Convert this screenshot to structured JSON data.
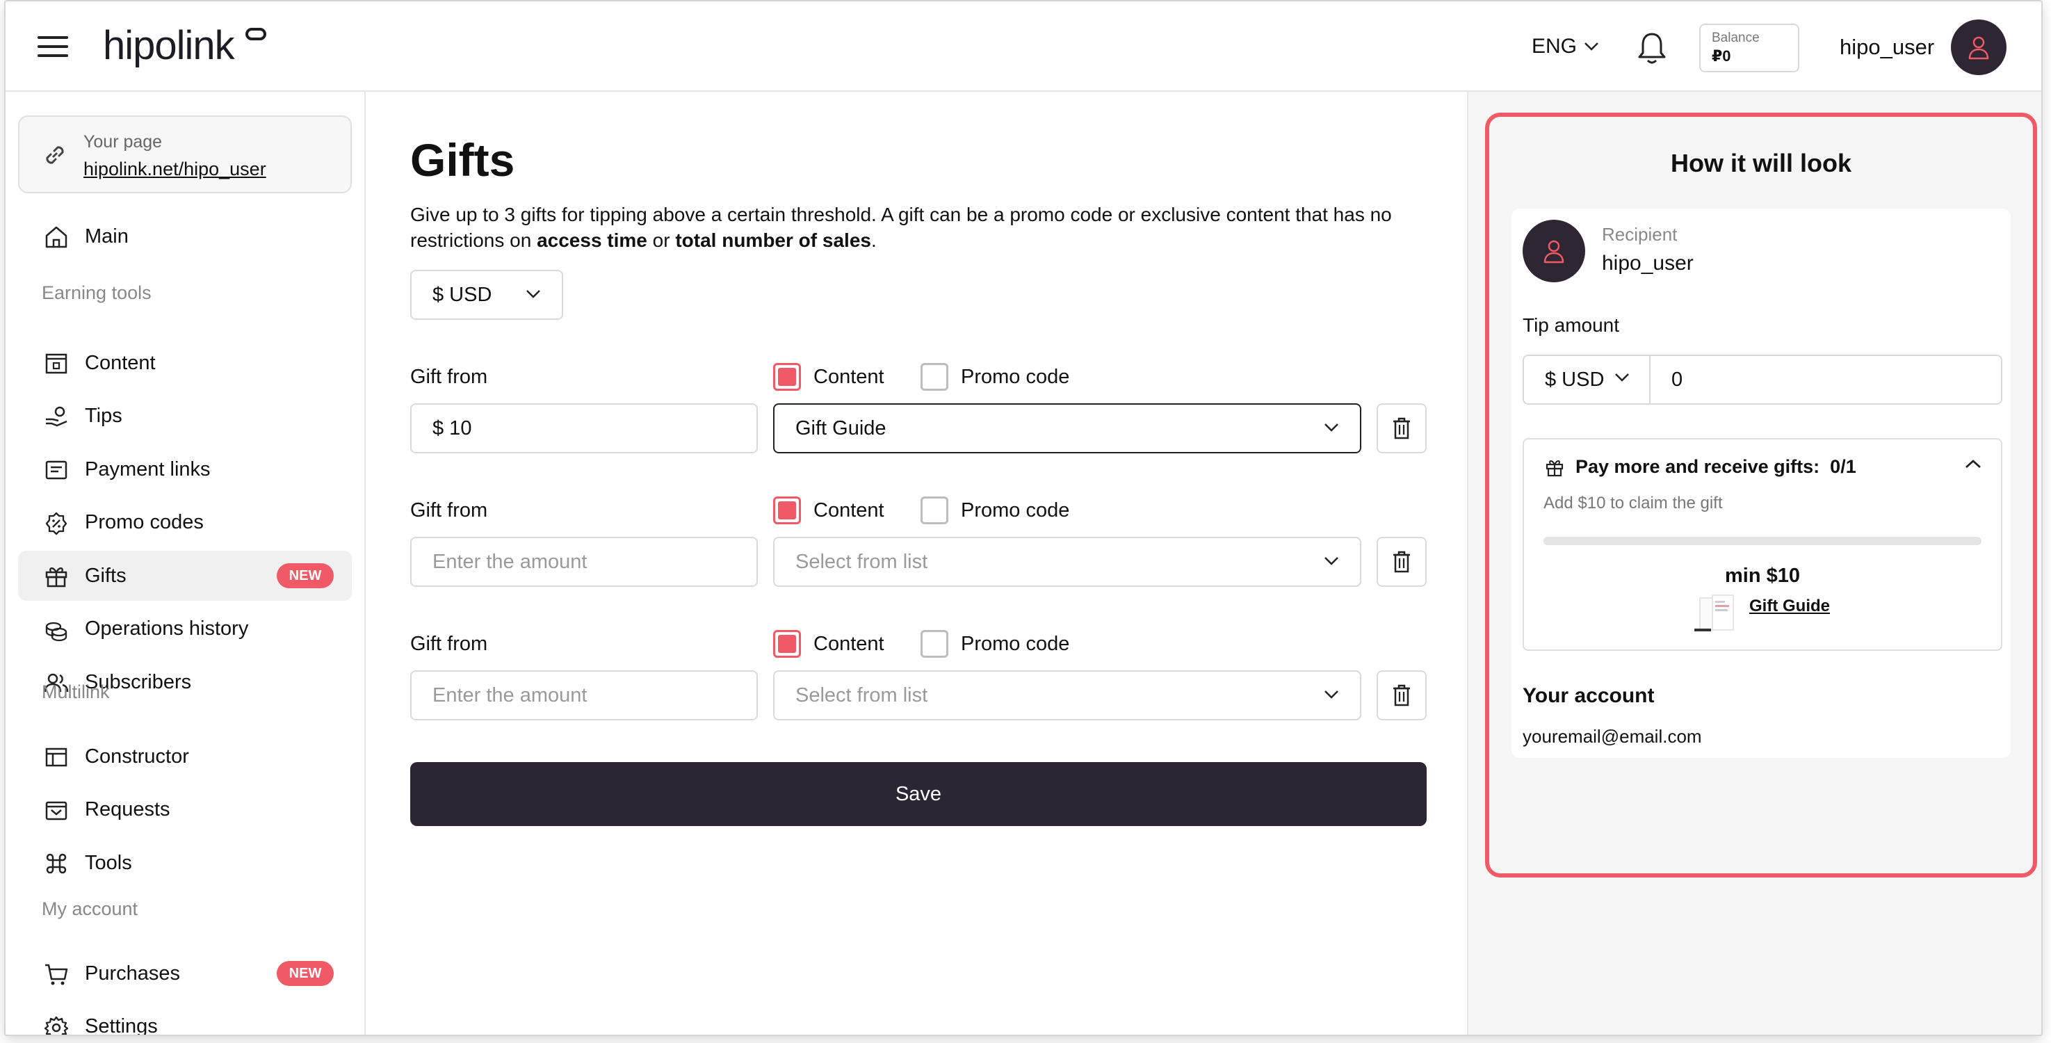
{
  "header": {
    "logo": "hipolink",
    "language": "ENG",
    "balance_label": "Balance",
    "balance_value": "₽0",
    "username": "hipo_user"
  },
  "sidebar": {
    "your_page_label": "Your page",
    "your_page_url": "hipolink.net/hipo_user",
    "main_label": "Main",
    "sections": {
      "earning": "Earning tools",
      "multilink": "Multilink",
      "account": "My account"
    },
    "earning_items": [
      {
        "label": "Content",
        "icon": "content-icon"
      },
      {
        "label": "Tips",
        "icon": "tips-icon"
      },
      {
        "label": "Payment links",
        "icon": "payment-links-icon"
      },
      {
        "label": "Promo codes",
        "icon": "promo-codes-icon"
      },
      {
        "label": "Gifts",
        "icon": "gift-icon",
        "badge": "NEW",
        "active": true
      },
      {
        "label": "Operations history",
        "icon": "operations-history-icon"
      },
      {
        "label": "Subscribers",
        "icon": "subscribers-icon"
      }
    ],
    "multilink_items": [
      {
        "label": "Constructor",
        "icon": "constructor-icon"
      },
      {
        "label": "Requests",
        "icon": "requests-icon"
      },
      {
        "label": "Tools",
        "icon": "tools-icon"
      }
    ],
    "account_items": [
      {
        "label": "Purchases",
        "icon": "cart-icon",
        "badge": "NEW"
      },
      {
        "label": "Settings",
        "icon": "gear-icon"
      }
    ]
  },
  "main": {
    "title": "Gifts",
    "desc_1": "Give up to 3 gifts for tipping above a certain threshold. A gift can be a promo code or exclusive content that has no restrictions on ",
    "desc_bold_1": "access time",
    "desc_2": " or ",
    "desc_bold_2": "total number of sales",
    "desc_3": ".",
    "currency": "$ USD",
    "gift_from_label": "Gift from",
    "content_label": "Content",
    "promo_label": "Promo code",
    "amount_placeholder": "Enter the amount",
    "list_placeholder": "Select from list",
    "rows": [
      {
        "amount": "$ 10",
        "selection": "Gift Guide",
        "content_checked": true,
        "promo_checked": false
      },
      {
        "amount": "",
        "selection": "",
        "content_checked": true,
        "promo_checked": false
      },
      {
        "amount": "",
        "selection": "",
        "content_checked": true,
        "promo_checked": false
      }
    ],
    "save_label": "Save"
  },
  "preview": {
    "title": "How it will look",
    "recipient_label": "Recipient",
    "recipient_name": "hipo_user",
    "tip_amount_label": "Tip amount",
    "tip_currency": "$ USD",
    "tip_value": "0",
    "gifts_heading": "Pay more and receive gifts:",
    "gifts_count": "0/1",
    "gifts_sub": "Add $10 to claim the gift",
    "progress_fraction": 0,
    "min_label": "min $10",
    "gift_name": "Gift Guide",
    "account_title": "Your account",
    "account_email": "youremail@email.com"
  },
  "colors": {
    "accent": "#f05a67",
    "dark": "#2c2634"
  }
}
